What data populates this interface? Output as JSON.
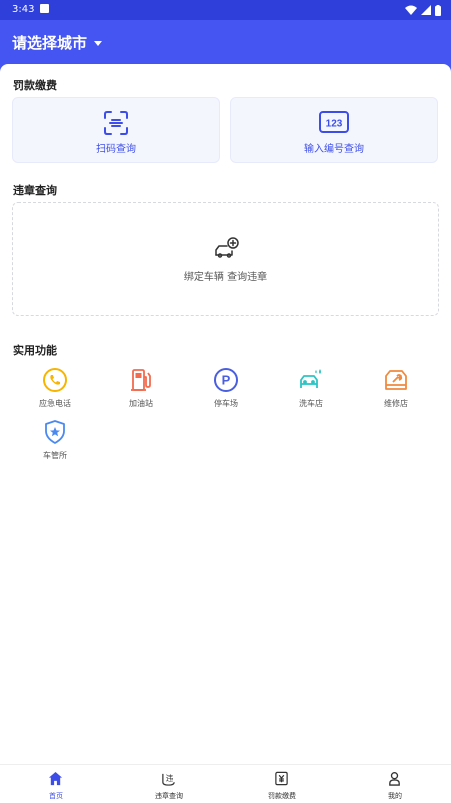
{
  "status_bar": {
    "time": "3:43"
  },
  "header": {
    "city_label": "请选择城市"
  },
  "fine_payment": {
    "title": "罚款缴费",
    "scan": {
      "label": "扫码查询",
      "icon": "scan-icon"
    },
    "input_number": {
      "label": "输入编号查询",
      "icon_text": "123",
      "icon": "number-input-icon"
    }
  },
  "violation_query": {
    "title": "违章查询",
    "bind_label": "绑定车辆 查询违章",
    "icon": "add-car-icon"
  },
  "utilities": {
    "title": "实用功能",
    "items": [
      {
        "label": "应急电话",
        "icon": "phone-icon",
        "color": "#f7b500"
      },
      {
        "label": "加油站",
        "icon": "gas-station-icon",
        "color": "#f26b4e"
      },
      {
        "label": "停车场",
        "icon": "parking-icon",
        "color": "#4a5fe0"
      },
      {
        "label": "洗车店",
        "icon": "car-wash-icon",
        "color": "#2ec4c4"
      },
      {
        "label": "维修店",
        "icon": "repair-shop-icon",
        "color": "#f08a3e"
      },
      {
        "label": "车管所",
        "icon": "vehicle-admin-icon",
        "color": "#4a8af0"
      }
    ]
  },
  "bottom_nav": {
    "items": [
      {
        "label": "首页",
        "icon": "home-icon",
        "active": true
      },
      {
        "label": "违章查询",
        "icon": "violation-icon",
        "active": false
      },
      {
        "label": "罚款缴费",
        "icon": "fine-icon",
        "active": false
      },
      {
        "label": "我的",
        "icon": "profile-icon",
        "active": false
      }
    ]
  },
  "colors": {
    "primary": "#4555f2",
    "accent_text": "#3d4ee8"
  }
}
